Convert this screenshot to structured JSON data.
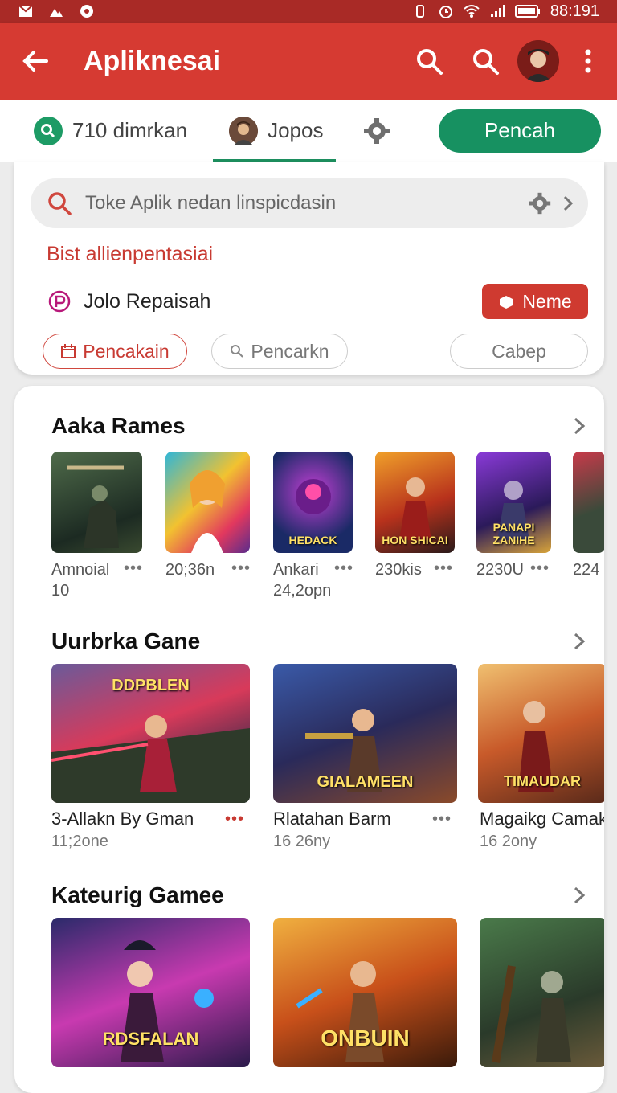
{
  "status": {
    "time": "88:191"
  },
  "app_bar": {
    "title": "Apliknesai"
  },
  "tabs": [
    {
      "label": "710 dimrkan"
    },
    {
      "label": "Jopos"
    }
  ],
  "primary_button": "Pencah",
  "search": {
    "placeholder": "Toke Aplik nedan linspicdasin"
  },
  "suggest_heading": "Bist allienpentasiai",
  "repo": {
    "label": "Jolo Repaisah",
    "button": "Neme"
  },
  "chips": [
    "Pencakain",
    "Pencarkn",
    "Cabep"
  ],
  "sections": [
    {
      "title": "Aaka Rames",
      "items": [
        {
          "name": "Amnoial",
          "sub": "10",
          "caption": ""
        },
        {
          "name": "20;36n",
          "sub": "",
          "caption": ""
        },
        {
          "name": "Ankari",
          "sub": "24,2opn",
          "caption": "HEDACK"
        },
        {
          "name": "230kis",
          "sub": "",
          "caption": "HON SHICAI"
        },
        {
          "name": "2230U",
          "sub": "",
          "caption": "PANAPI ZANIHE"
        },
        {
          "name": "224",
          "sub": "",
          "caption": ""
        }
      ]
    },
    {
      "title": "Uurbrka Gane",
      "items": [
        {
          "name": "3-Allakn By Gman",
          "sub": "11;2one",
          "caption": "DDPBLEN"
        },
        {
          "name": "Rlatahan Barm",
          "sub": "16 26ny",
          "caption": "GIALAMEEN"
        },
        {
          "name": "Magaikg Camaka",
          "sub": "16 2ony",
          "caption": "TIMAUDAR"
        }
      ]
    },
    {
      "title": "Kateurig Gamee",
      "items": [
        {
          "name": "",
          "sub": "",
          "caption": "RDSFALAN"
        },
        {
          "name": "",
          "sub": "",
          "caption": "ONBUIN"
        },
        {
          "name": "",
          "sub": "",
          "caption": ""
        }
      ]
    }
  ],
  "colors": {
    "status_bar": "#a92a26",
    "app_bar": "#d63a32",
    "accent_green": "#179161",
    "accent_red": "#cf3a30"
  }
}
